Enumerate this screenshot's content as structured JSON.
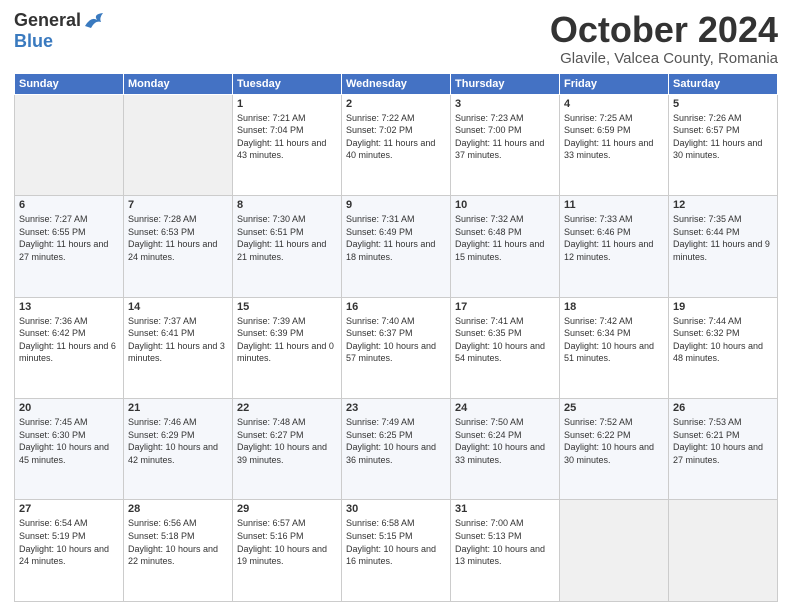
{
  "header": {
    "logo_general": "General",
    "logo_blue": "Blue",
    "month_title": "October 2024",
    "location": "Glavile, Valcea County, Romania"
  },
  "weekdays": [
    "Sunday",
    "Monday",
    "Tuesday",
    "Wednesday",
    "Thursday",
    "Friday",
    "Saturday"
  ],
  "weeks": [
    [
      {
        "day": "",
        "sunrise": "",
        "sunset": "",
        "daylight": ""
      },
      {
        "day": "",
        "sunrise": "",
        "sunset": "",
        "daylight": ""
      },
      {
        "day": "1",
        "sunrise": "Sunrise: 7:21 AM",
        "sunset": "Sunset: 7:04 PM",
        "daylight": "Daylight: 11 hours and 43 minutes."
      },
      {
        "day": "2",
        "sunrise": "Sunrise: 7:22 AM",
        "sunset": "Sunset: 7:02 PM",
        "daylight": "Daylight: 11 hours and 40 minutes."
      },
      {
        "day": "3",
        "sunrise": "Sunrise: 7:23 AM",
        "sunset": "Sunset: 7:00 PM",
        "daylight": "Daylight: 11 hours and 37 minutes."
      },
      {
        "day": "4",
        "sunrise": "Sunrise: 7:25 AM",
        "sunset": "Sunset: 6:59 PM",
        "daylight": "Daylight: 11 hours and 33 minutes."
      },
      {
        "day": "5",
        "sunrise": "Sunrise: 7:26 AM",
        "sunset": "Sunset: 6:57 PM",
        "daylight": "Daylight: 11 hours and 30 minutes."
      }
    ],
    [
      {
        "day": "6",
        "sunrise": "Sunrise: 7:27 AM",
        "sunset": "Sunset: 6:55 PM",
        "daylight": "Daylight: 11 hours and 27 minutes."
      },
      {
        "day": "7",
        "sunrise": "Sunrise: 7:28 AM",
        "sunset": "Sunset: 6:53 PM",
        "daylight": "Daylight: 11 hours and 24 minutes."
      },
      {
        "day": "8",
        "sunrise": "Sunrise: 7:30 AM",
        "sunset": "Sunset: 6:51 PM",
        "daylight": "Daylight: 11 hours and 21 minutes."
      },
      {
        "day": "9",
        "sunrise": "Sunrise: 7:31 AM",
        "sunset": "Sunset: 6:49 PM",
        "daylight": "Daylight: 11 hours and 18 minutes."
      },
      {
        "day": "10",
        "sunrise": "Sunrise: 7:32 AM",
        "sunset": "Sunset: 6:48 PM",
        "daylight": "Daylight: 11 hours and 15 minutes."
      },
      {
        "day": "11",
        "sunrise": "Sunrise: 7:33 AM",
        "sunset": "Sunset: 6:46 PM",
        "daylight": "Daylight: 11 hours and 12 minutes."
      },
      {
        "day": "12",
        "sunrise": "Sunrise: 7:35 AM",
        "sunset": "Sunset: 6:44 PM",
        "daylight": "Daylight: 11 hours and 9 minutes."
      }
    ],
    [
      {
        "day": "13",
        "sunrise": "Sunrise: 7:36 AM",
        "sunset": "Sunset: 6:42 PM",
        "daylight": "Daylight: 11 hours and 6 minutes."
      },
      {
        "day": "14",
        "sunrise": "Sunrise: 7:37 AM",
        "sunset": "Sunset: 6:41 PM",
        "daylight": "Daylight: 11 hours and 3 minutes."
      },
      {
        "day": "15",
        "sunrise": "Sunrise: 7:39 AM",
        "sunset": "Sunset: 6:39 PM",
        "daylight": "Daylight: 11 hours and 0 minutes."
      },
      {
        "day": "16",
        "sunrise": "Sunrise: 7:40 AM",
        "sunset": "Sunset: 6:37 PM",
        "daylight": "Daylight: 10 hours and 57 minutes."
      },
      {
        "day": "17",
        "sunrise": "Sunrise: 7:41 AM",
        "sunset": "Sunset: 6:35 PM",
        "daylight": "Daylight: 10 hours and 54 minutes."
      },
      {
        "day": "18",
        "sunrise": "Sunrise: 7:42 AM",
        "sunset": "Sunset: 6:34 PM",
        "daylight": "Daylight: 10 hours and 51 minutes."
      },
      {
        "day": "19",
        "sunrise": "Sunrise: 7:44 AM",
        "sunset": "Sunset: 6:32 PM",
        "daylight": "Daylight: 10 hours and 48 minutes."
      }
    ],
    [
      {
        "day": "20",
        "sunrise": "Sunrise: 7:45 AM",
        "sunset": "Sunset: 6:30 PM",
        "daylight": "Daylight: 10 hours and 45 minutes."
      },
      {
        "day": "21",
        "sunrise": "Sunrise: 7:46 AM",
        "sunset": "Sunset: 6:29 PM",
        "daylight": "Daylight: 10 hours and 42 minutes."
      },
      {
        "day": "22",
        "sunrise": "Sunrise: 7:48 AM",
        "sunset": "Sunset: 6:27 PM",
        "daylight": "Daylight: 10 hours and 39 minutes."
      },
      {
        "day": "23",
        "sunrise": "Sunrise: 7:49 AM",
        "sunset": "Sunset: 6:25 PM",
        "daylight": "Daylight: 10 hours and 36 minutes."
      },
      {
        "day": "24",
        "sunrise": "Sunrise: 7:50 AM",
        "sunset": "Sunset: 6:24 PM",
        "daylight": "Daylight: 10 hours and 33 minutes."
      },
      {
        "day": "25",
        "sunrise": "Sunrise: 7:52 AM",
        "sunset": "Sunset: 6:22 PM",
        "daylight": "Daylight: 10 hours and 30 minutes."
      },
      {
        "day": "26",
        "sunrise": "Sunrise: 7:53 AM",
        "sunset": "Sunset: 6:21 PM",
        "daylight": "Daylight: 10 hours and 27 minutes."
      }
    ],
    [
      {
        "day": "27",
        "sunrise": "Sunrise: 6:54 AM",
        "sunset": "Sunset: 5:19 PM",
        "daylight": "Daylight: 10 hours and 24 minutes."
      },
      {
        "day": "28",
        "sunrise": "Sunrise: 6:56 AM",
        "sunset": "Sunset: 5:18 PM",
        "daylight": "Daylight: 10 hours and 22 minutes."
      },
      {
        "day": "29",
        "sunrise": "Sunrise: 6:57 AM",
        "sunset": "Sunset: 5:16 PM",
        "daylight": "Daylight: 10 hours and 19 minutes."
      },
      {
        "day": "30",
        "sunrise": "Sunrise: 6:58 AM",
        "sunset": "Sunset: 5:15 PM",
        "daylight": "Daylight: 10 hours and 16 minutes."
      },
      {
        "day": "31",
        "sunrise": "Sunrise: 7:00 AM",
        "sunset": "Sunset: 5:13 PM",
        "daylight": "Daylight: 10 hours and 13 minutes."
      },
      {
        "day": "",
        "sunrise": "",
        "sunset": "",
        "daylight": ""
      },
      {
        "day": "",
        "sunrise": "",
        "sunset": "",
        "daylight": ""
      }
    ]
  ]
}
